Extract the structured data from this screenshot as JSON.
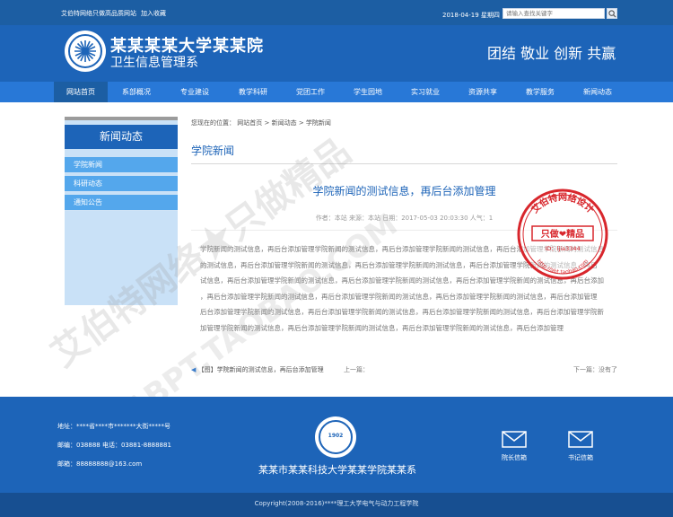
{
  "topbar": {
    "welcome": "艾伯特网络只做高品质网站",
    "favorite": "加入收藏",
    "date": "2018-04-19 星期四",
    "search_placeholder": "请输入查找关键字"
  },
  "header": {
    "school_name": "某某某某大学某某院",
    "dept_name": "卫生信息管理系",
    "slogan": "团结 敬业 创新 共赢"
  },
  "nav": {
    "items": [
      "网站首页",
      "系部概况",
      "专业建设",
      "教学科研",
      "党团工作",
      "学生园地",
      "实习就业",
      "资源共享",
      "教学服务",
      "新闻动态"
    ]
  },
  "sidebar": {
    "title": "新闻动态",
    "items": [
      "学院新闻",
      "科研动态",
      "通知公告"
    ]
  },
  "breadcrumb": {
    "prefix": "您现在的位置：",
    "home": "网站首页",
    "sep": ">",
    "level1": "新闻动态",
    "level2": "学院新闻"
  },
  "main": {
    "section_title": "学院新闻",
    "article_title": "学院新闻的测试信息，再后台添加管理",
    "meta": "作者：本站    来源：本站    日期：2017-05-03 20:03:30    人气：1",
    "body_lines": [
      "学院新闻的测试信息，再后台添加管理学院新闻的测试信息，再后台添加管理学院新闻的测试信息，再后台添加管理学院新闻的测试信息",
      "的测试信息，再后台添加管理学院新闻的测试信息，再后台添加管理学院新闻的测试信息，再后台添加管理学院新闻的测试信息，再后",
      "试信息，再后台添加管理学院新闻的测试信息，再后台添加管理学院新闻的测试信息，再后台添加管理学院新闻的测试信息，再后台添加",
      "，再后台添加管理学院新闻的测试信息，再后台添加管理学院新闻的测试信息，再后台添加管理学院新闻的测试信息，再后台添加管理",
      "后台添加管理学院新闻的测试信息，再后台添加管理学院新闻的测试信息，再后台添加管理学院新闻的测试信息，再后台添加管理学院新",
      "加管理学院新闻的测试信息，再后台添加管理学院新闻的测试信息，再后台添加管理学院新闻的测试信息，再后台添加管理"
    ],
    "prev_label": "【图】学院新闻的测试信息，再后台添加管理",
    "prev2_label": "上一篇：",
    "next_label": "下一篇：没有了"
  },
  "stamp": {
    "top_text": "艾伯特网络设计",
    "middle_text": "只做❤精品",
    "id_text": "ID：ljia3344",
    "url_text": "http://abt.taobao.com"
  },
  "watermark": {
    "text": "艾伯特网络★只做精品",
    "url": "ABPT.TAOBAO.COM"
  },
  "footer": {
    "address": "地址：****省****市*******大街*****号",
    "postcode": "邮编：038888    电话：03881-8888881",
    "email": "邮箱：88888888@163.com",
    "seal_year": "1902",
    "school_full_name": "某某市某某科技大学某某学院某某系",
    "mail1_label": "院长信箱",
    "mail2_label": "书记信箱",
    "copyright": "Copyright(2008-2016)****理工大学电气与动力工程学院"
  },
  "colors": {
    "primary": "#1d64b8",
    "nav": "#2878d7",
    "sidebar_item": "#54a7ec",
    "stamp": "#d8262c"
  }
}
